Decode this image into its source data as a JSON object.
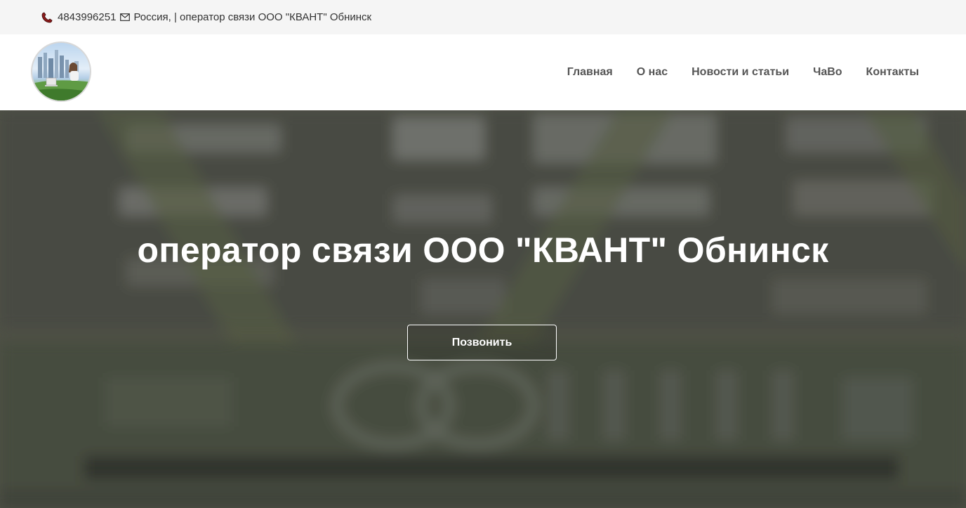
{
  "topbar": {
    "phone": "4843996251",
    "address": "Россия, | оператор связи ООО \"КВАНТ\" Обнинск"
  },
  "nav": {
    "items": [
      "Главная",
      "О нас",
      "Новости и статьи",
      "ЧаВо",
      "Контакты"
    ]
  },
  "hero": {
    "title": "оператор связи ООО \"КВАНТ\" Обнинск",
    "button_label": "Позвонить"
  },
  "colors": {
    "topbar_bg": "#f5f5f5",
    "hero_overlay": "#55574b",
    "nav_text": "#555555",
    "phone_icon": "#c0392b"
  }
}
